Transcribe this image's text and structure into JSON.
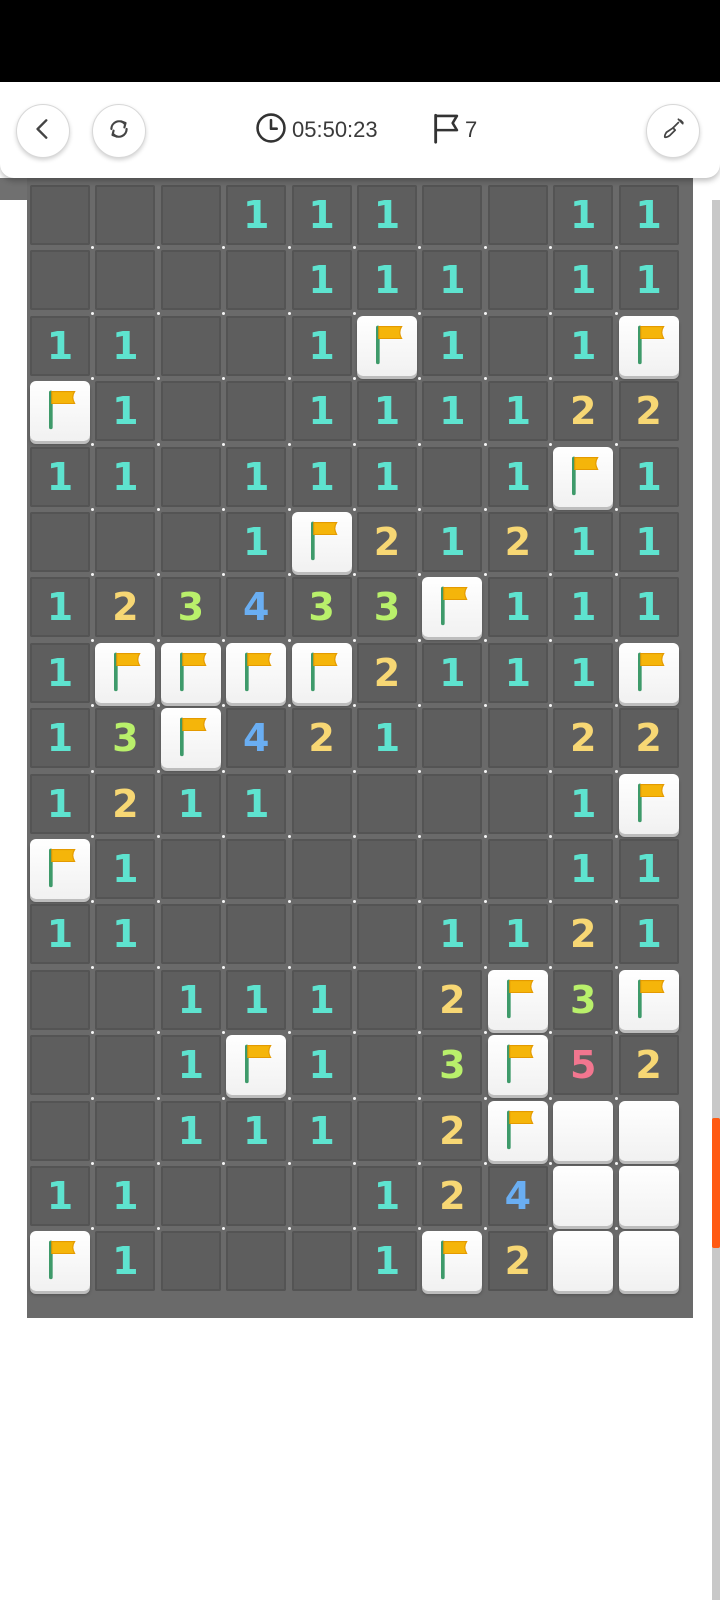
{
  "header": {
    "timer": "05:50:23",
    "flag_count": "7"
  },
  "icons": {
    "back": "chevron-left-icon",
    "restart": "refresh-icon",
    "timer": "clock-icon",
    "flags": "flag-outline-icon",
    "hint": "shovel-icon"
  },
  "colors": {
    "number_1": "#5ee3cf",
    "number_2": "#f7d774",
    "number_3": "#b9f06b",
    "number_4": "#6aaef2",
    "number_5": "#f2768f",
    "flag": "#f5b50a",
    "flag_pole": "#3e9a6a",
    "accent_scroll": "#ff5a12"
  },
  "board": {
    "rows": 17,
    "cols": 10,
    "legend": "digit = revealed number, '.' = revealed empty, 'F' = flagged, 'H' = hidden",
    "grid": [
      "...111..11",
      "....111.11",
      "11..1F1.1F",
      "F1..11112 2",
      "11.111.1F1",
      "...1F21211",
      "12343 3F111",
      "1FFFF2111F",
      "13F421..22",
      "1211....1F",
      "F1......11",
      "11....1121",
      "..111.2F3F",
      "..1F1.3F52",
      "..111.2FHH",
      "11...124HH",
      "F1...1F2HH"
    ]
  }
}
